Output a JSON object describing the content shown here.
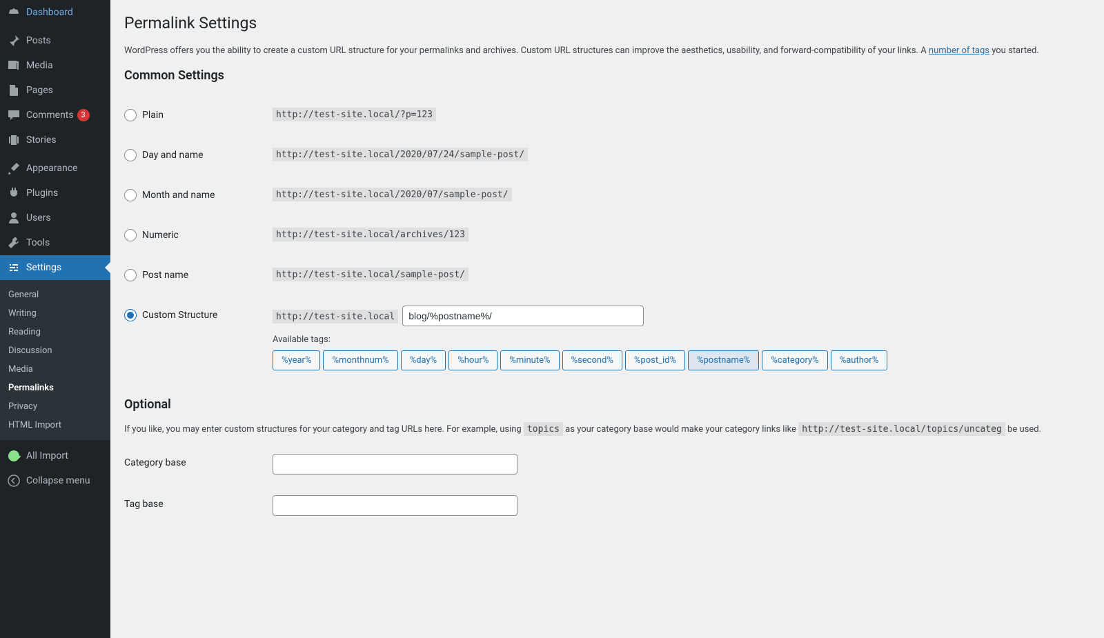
{
  "sidebar": {
    "items": [
      {
        "icon": "dashboard",
        "label": "Dashboard"
      },
      {
        "icon": "pin",
        "label": "Posts"
      },
      {
        "icon": "media",
        "label": "Media"
      },
      {
        "icon": "page",
        "label": "Pages"
      },
      {
        "icon": "comment",
        "label": "Comments",
        "badge": "3"
      },
      {
        "icon": "stories",
        "label": "Stories"
      },
      {
        "icon": "brush",
        "label": "Appearance"
      },
      {
        "icon": "plugin",
        "label": "Plugins"
      },
      {
        "icon": "user",
        "label": "Users"
      },
      {
        "icon": "wrench",
        "label": "Tools"
      },
      {
        "icon": "settings",
        "label": "Settings",
        "current": true
      },
      {
        "icon": "allimport",
        "label": "All Import"
      },
      {
        "icon": "collapse",
        "label": "Collapse menu"
      }
    ],
    "submenu": {
      "parent": 10,
      "items": [
        {
          "label": "General"
        },
        {
          "label": "Writing"
        },
        {
          "label": "Reading"
        },
        {
          "label": "Discussion"
        },
        {
          "label": "Media"
        },
        {
          "label": "Permalinks",
          "active": true
        },
        {
          "label": "Privacy"
        },
        {
          "label": "HTML Import"
        }
      ]
    }
  },
  "page": {
    "title": "Permalink Settings",
    "intro_a": "WordPress offers you the ability to create a custom URL structure for your permalinks and archives. Custom URL structures can improve the aesthetics, usability, and forward-compatibility of your links. A ",
    "intro_link": "number of tags",
    "intro_b": " you started.",
    "common_heading": "Common Settings",
    "options": [
      {
        "label": "Plain",
        "example": "http://test-site.local/?p=123"
      },
      {
        "label": "Day and name",
        "example": "http://test-site.local/2020/07/24/sample-post/"
      },
      {
        "label": "Month and name",
        "example": "http://test-site.local/2020/07/sample-post/"
      },
      {
        "label": "Numeric",
        "example": "http://test-site.local/archives/123"
      },
      {
        "label": "Post name",
        "example": "http://test-site.local/sample-post/"
      }
    ],
    "custom": {
      "label": "Custom Structure",
      "base_url": "http://test-site.local",
      "value": "blog/%postname%/",
      "available_label": "Available tags:",
      "tags": [
        "%year%",
        "%monthnum%",
        "%day%",
        "%hour%",
        "%minute%",
        "%second%",
        "%post_id%",
        "%postname%",
        "%category%",
        "%author%"
      ],
      "active_tag": "%postname%"
    },
    "optional": {
      "heading": "Optional",
      "text_a": "If you like, you may enter custom structures for your category and tag URLs here. For example, using ",
      "code1": "topics",
      "text_b": " as your category base would make your category links like ",
      "code2": "http://test-site.local/topics/uncateg",
      "text_c": " be used.",
      "category_label": "Category base",
      "category_value": "",
      "tag_label": "Tag base",
      "tag_value": ""
    }
  }
}
